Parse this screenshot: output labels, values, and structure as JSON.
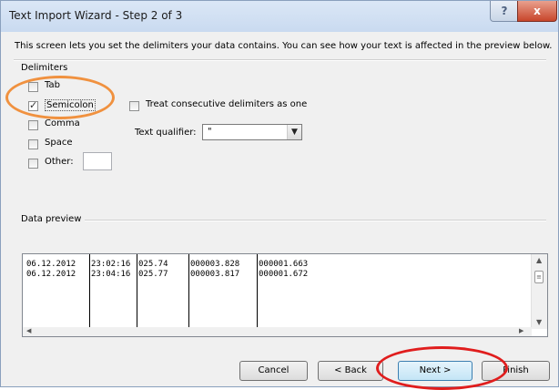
{
  "window": {
    "title": "Text Import Wizard - Step 2 of 3",
    "help_label": "?",
    "close_label": "x"
  },
  "description": "This screen lets you set the delimiters your data contains.  You can see how your text is affected in the preview below.",
  "delimiters": {
    "heading": "Delimiters",
    "tab": {
      "label": "Tab",
      "checked": false
    },
    "semicolon": {
      "label": "Semicolon",
      "checked": true
    },
    "comma": {
      "label": "Comma",
      "checked": false
    },
    "space": {
      "label": "Space",
      "checked": false
    },
    "other": {
      "label": "Other:",
      "checked": false,
      "value": ""
    }
  },
  "consecutive": {
    "label": "Treat consecutive delimiters as one",
    "checked": false
  },
  "qualifier": {
    "label": "Text qualifier:",
    "value": "\""
  },
  "preview": {
    "heading": "Data preview",
    "rows": [
      [
        "06.12.2012",
        "23:02:16",
        "025.74",
        "000003.828",
        "000001.663"
      ],
      [
        "06.12.2012",
        "23:04:16",
        "025.77",
        "000003.817",
        "000001.672"
      ]
    ]
  },
  "buttons": {
    "cancel": "Cancel",
    "back": "< Back",
    "next": "Next >",
    "finish": "Finish"
  },
  "colors": {
    "highlight_orange": "#f0913f",
    "highlight_red": "#e01d1d"
  }
}
